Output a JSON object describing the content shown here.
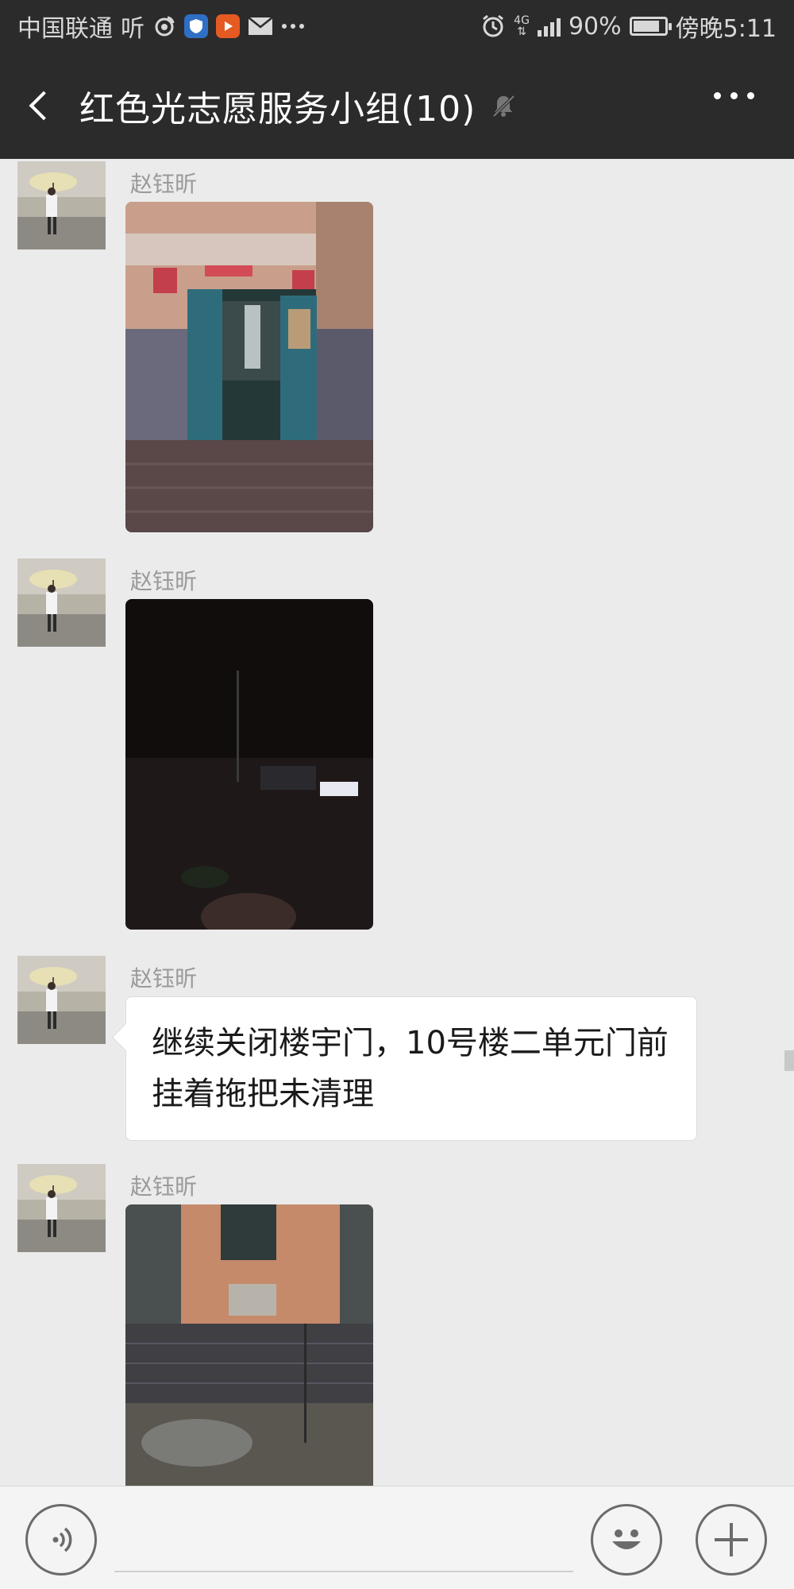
{
  "status_bar": {
    "carrier": "中国联通",
    "app_label": "听",
    "network": "4G",
    "battery": "90%",
    "battery_level": 0.9,
    "time": "傍晚5:11"
  },
  "header": {
    "title": "红色光志愿服务小组(10)"
  },
  "messages": [
    {
      "sender": "赵钰昕",
      "kind": "image",
      "image_desc": "building-doorway-day"
    },
    {
      "sender": "赵钰昕",
      "kind": "image",
      "image_desc": "dark-night-street"
    },
    {
      "sender": "赵钰昕",
      "kind": "text",
      "text": "继续关闭楼宇门，10号楼二单元门前挂着拖把未清理"
    },
    {
      "sender": "赵钰昕",
      "kind": "image",
      "image_desc": "building-wall-rain"
    }
  ],
  "icons": {
    "back": "chevron-left-icon",
    "mute": "bell-muted-icon",
    "more": "more-dots-icon",
    "voice": "voice-icon",
    "emoji": "emoji-icon",
    "plus": "plus-icon"
  },
  "colors": {
    "header_bg": "#2b2b2b",
    "chat_bg": "#ebebeb",
    "bubble_bg": "#ffffff",
    "name_text": "#9a9a9a"
  }
}
